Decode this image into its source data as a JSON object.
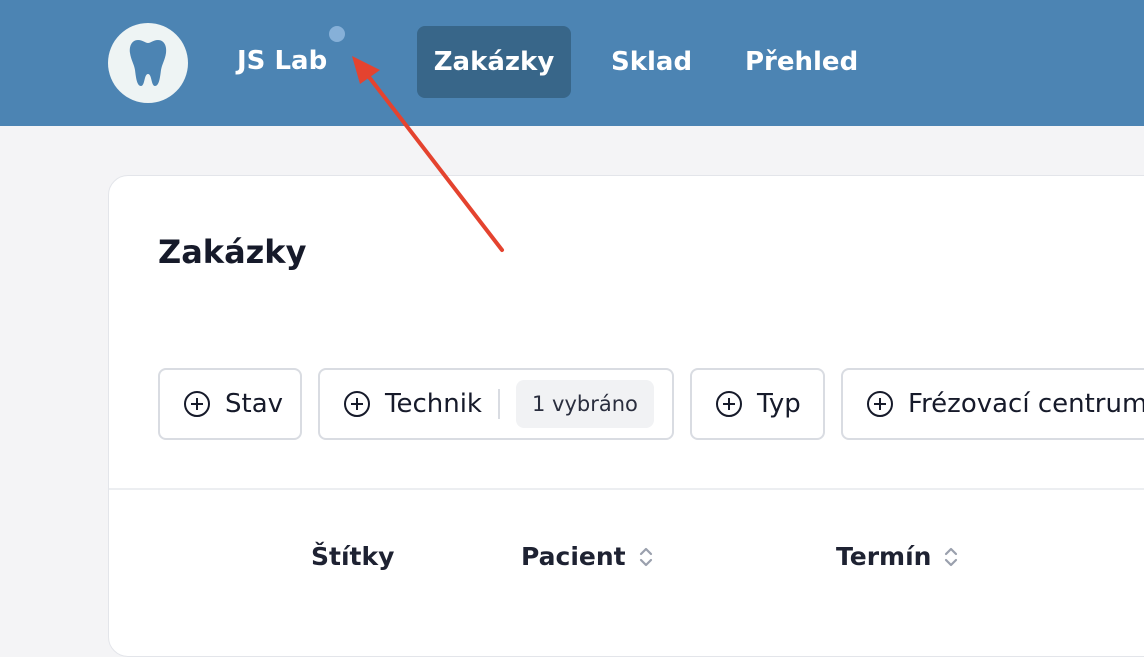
{
  "header": {
    "brand": "JS Lab",
    "nav": [
      {
        "label": "Zakázky",
        "active": true
      },
      {
        "label": "Sklad",
        "active": false
      },
      {
        "label": "Přehled",
        "active": false
      }
    ]
  },
  "icons": {
    "logo": "tooth-icon",
    "filter": "plus-circle-icon",
    "sort": "sort-arrows-icon"
  },
  "main": {
    "title": "Zakázky",
    "filters": [
      {
        "label": "Stav"
      },
      {
        "label": "Technik",
        "badge": "1 vybráno"
      },
      {
        "label": "Typ"
      },
      {
        "label": "Frézovací centrum"
      }
    ],
    "table": {
      "columns": [
        "Štítky",
        "Pacient",
        "Termín"
      ]
    }
  },
  "colors": {
    "header_bg": "#4c84b3",
    "nav_active_bg": "#386689",
    "annotation_arrow": "#e4432f"
  }
}
